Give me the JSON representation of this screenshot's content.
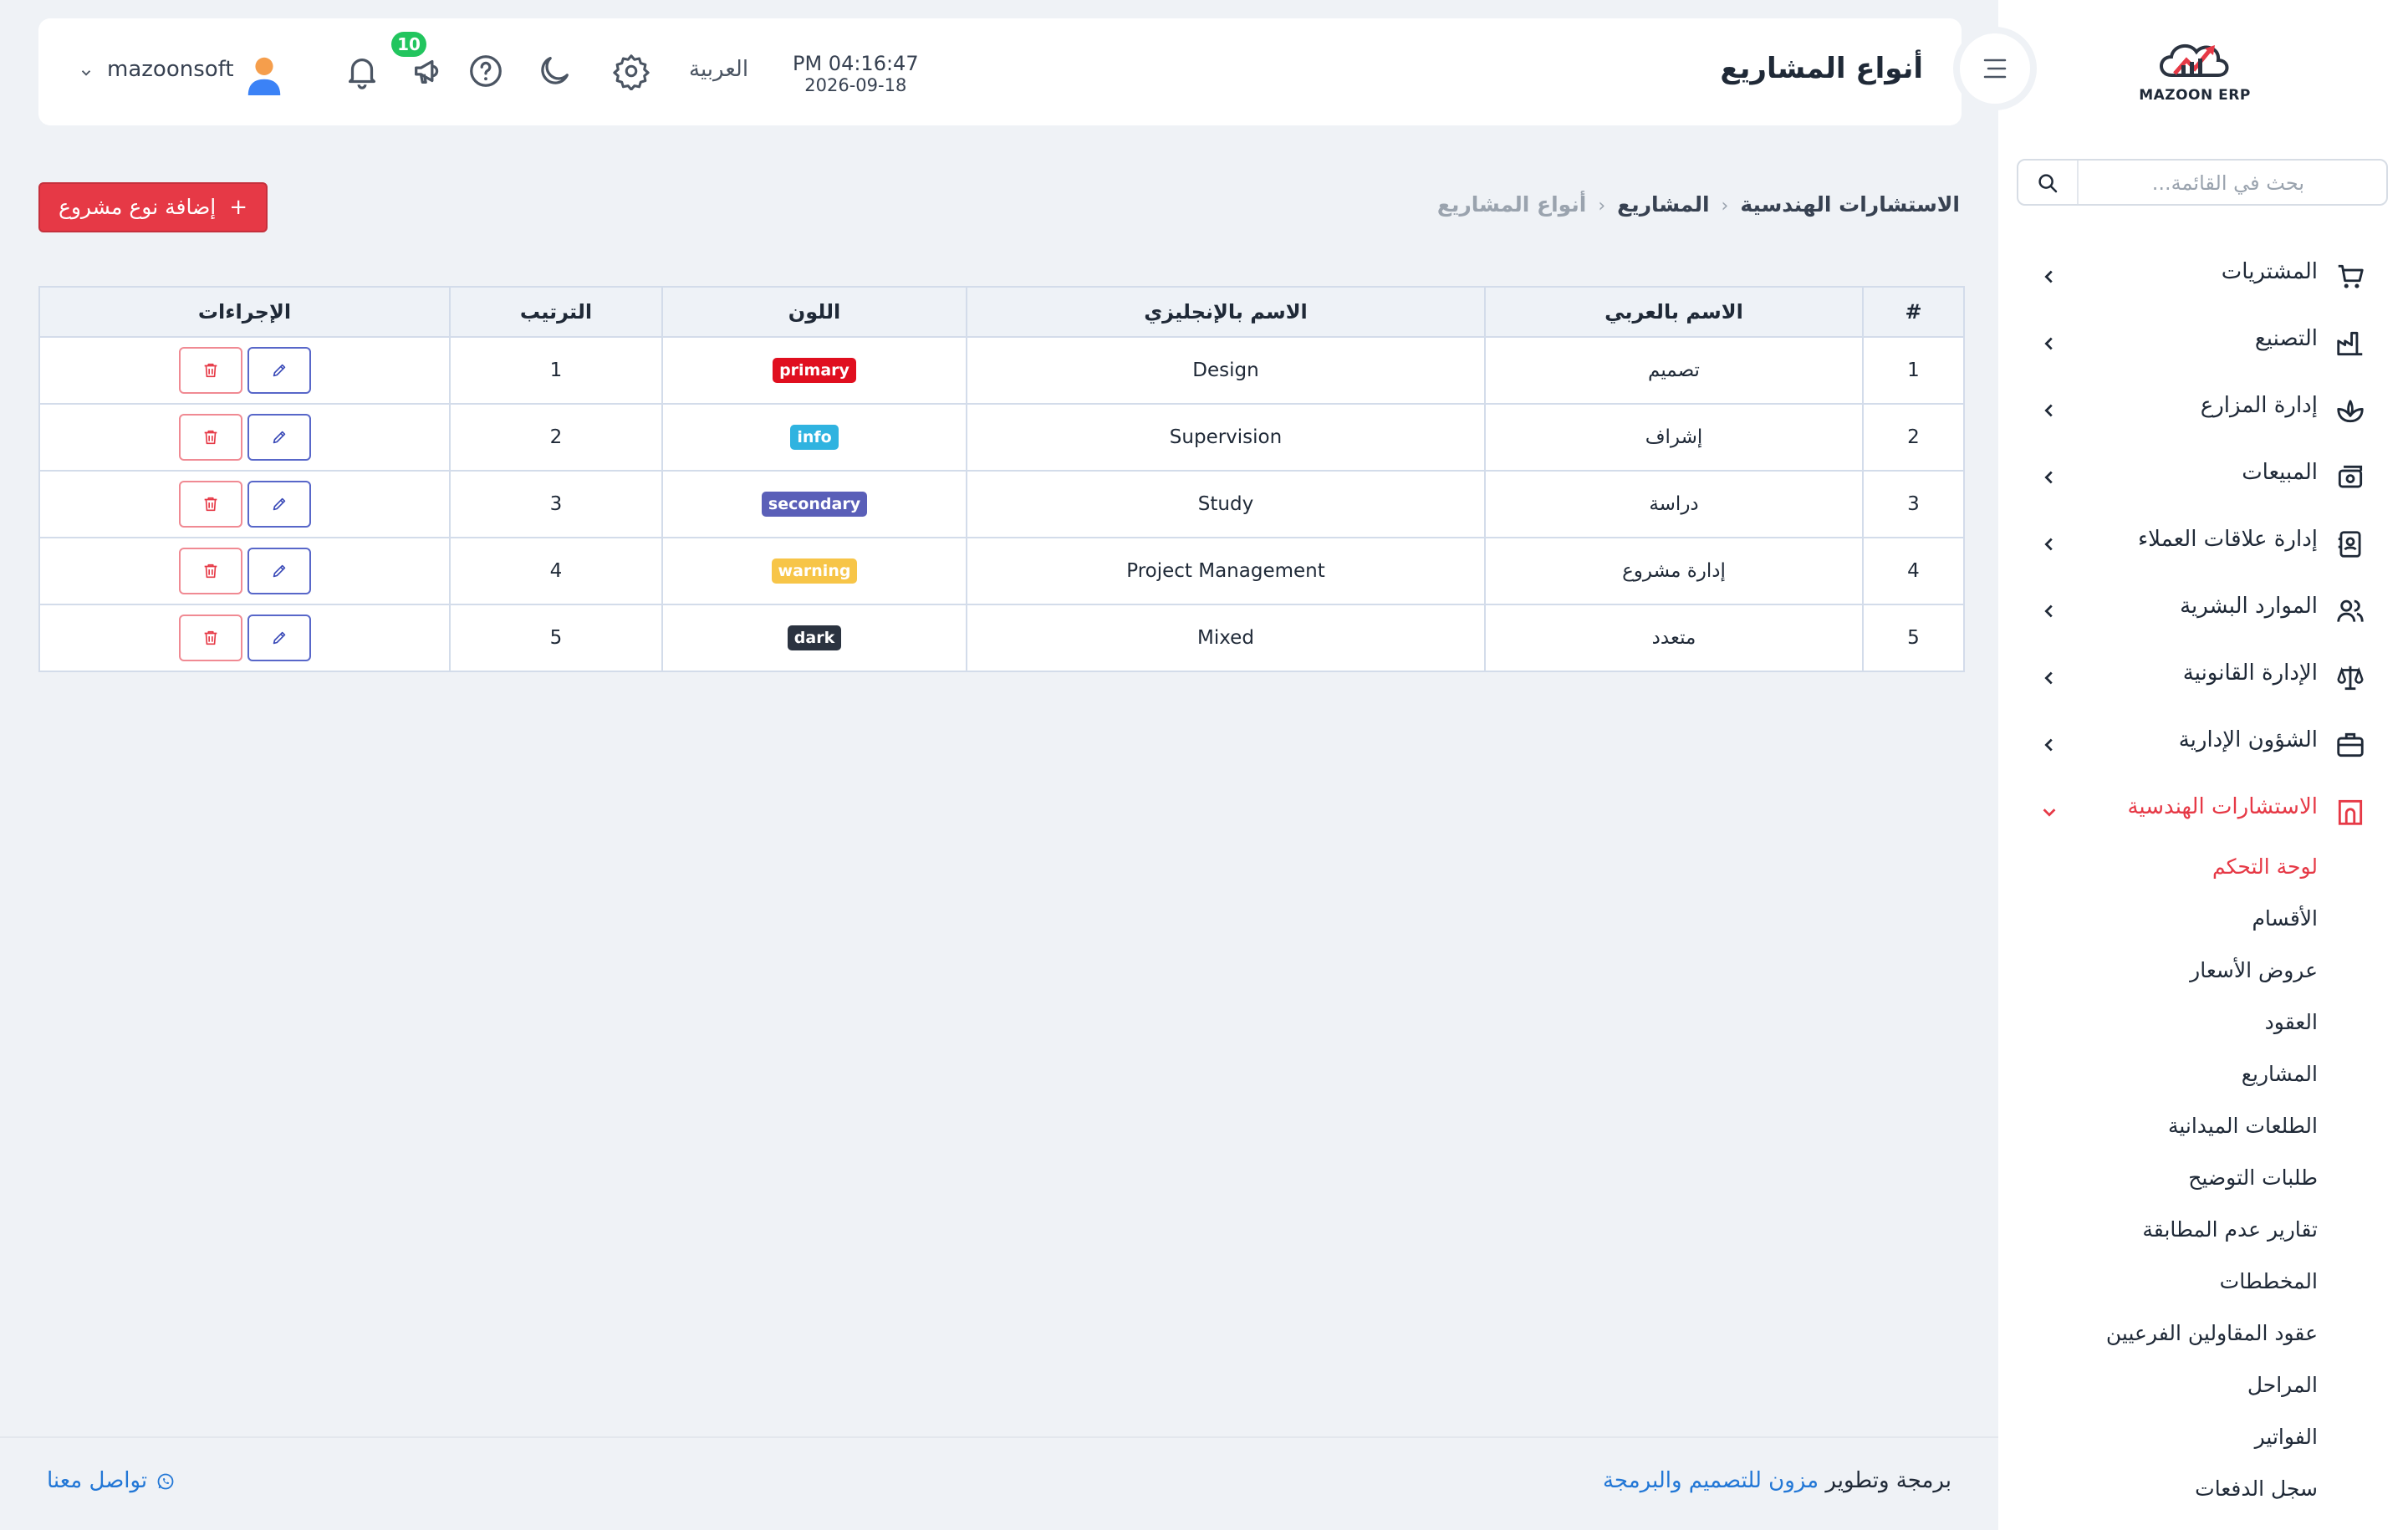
{
  "sidebar": {
    "logo_text": "MAZOON ERP",
    "search_placeholder": "بحث في القائمة...",
    "items": [
      {
        "label": "المشتريات",
        "icon": "cart-icon"
      },
      {
        "label": "التصنيع",
        "icon": "factory-icon"
      },
      {
        "label": "إدارة المزارع",
        "icon": "plant-icon"
      },
      {
        "label": "المبيعات",
        "icon": "cash-icon"
      },
      {
        "label": "إدارة علاقات العملاء",
        "icon": "contacts-icon"
      },
      {
        "label": "الموارد البشرية",
        "icon": "users-icon"
      },
      {
        "label": "الإدارة القانونية",
        "icon": "scale-icon"
      },
      {
        "label": "الشؤون الإدارية",
        "icon": "briefcase-icon"
      },
      {
        "label": "الاستشارات الهندسية",
        "icon": "building-icon"
      }
    ],
    "submenu": [
      "لوحة التحكم",
      "الأقسام",
      "عروض الأسعار",
      "العقود",
      "المشاريع",
      "الطلعات الميدانية",
      "طلبات التوضيح",
      "تقارير عدم المطابقة",
      "المخططات",
      "عقود المقاولين الفرعيين",
      "المراحل",
      "الفواتير",
      "سجل الدفعات"
    ]
  },
  "topbar": {
    "title": "أنواع المشاريع",
    "time": "PM 04:16:47",
    "date": "2026-09-18",
    "language": "العربية",
    "notification_badge": "10",
    "username": "mazoonsoft"
  },
  "breadcrumb": {
    "item1": "الاستشارات الهندسية",
    "item2": "المشاريع",
    "item3": "أنواع المشاريع"
  },
  "add_button": "إضافة نوع مشروع",
  "table": {
    "headers": {
      "num": "#",
      "name_ar": "الاسم بالعربي",
      "name_en": "الاسم بالإنجليزي",
      "color": "اللون",
      "order": "الترتيب",
      "actions": "الإجراءات"
    },
    "rows": [
      {
        "num": "1",
        "name_ar": "تصميم",
        "name_en": "Design",
        "color": "primary",
        "color_hex": "#e00f1f",
        "order": "1"
      },
      {
        "num": "2",
        "name_ar": "إشراف",
        "name_en": "Supervision",
        "color": "info",
        "color_hex": "#2fb3e0",
        "order": "2"
      },
      {
        "num": "3",
        "name_ar": "دراسة",
        "name_en": "Study",
        "color": "secondary",
        "color_hex": "#5a5fb8",
        "order": "3"
      },
      {
        "num": "4",
        "name_ar": "إدارة مشروع",
        "name_en": "Project Management",
        "color": "warning",
        "color_hex": "#f7c548",
        "order": "4"
      },
      {
        "num": "5",
        "name_ar": "متعدد",
        "name_en": "Mixed",
        "color": "dark",
        "color_hex": "#2b3340",
        "order": "5"
      }
    ]
  },
  "footer": {
    "prefix": "برمجة وتطوير",
    "company": "مزون للتصميم والبرمجة",
    "contact": "تواصل معنا"
  },
  "colors": {
    "accent": "#e63946",
    "link": "#2277d6",
    "badge": "#22c55e"
  }
}
